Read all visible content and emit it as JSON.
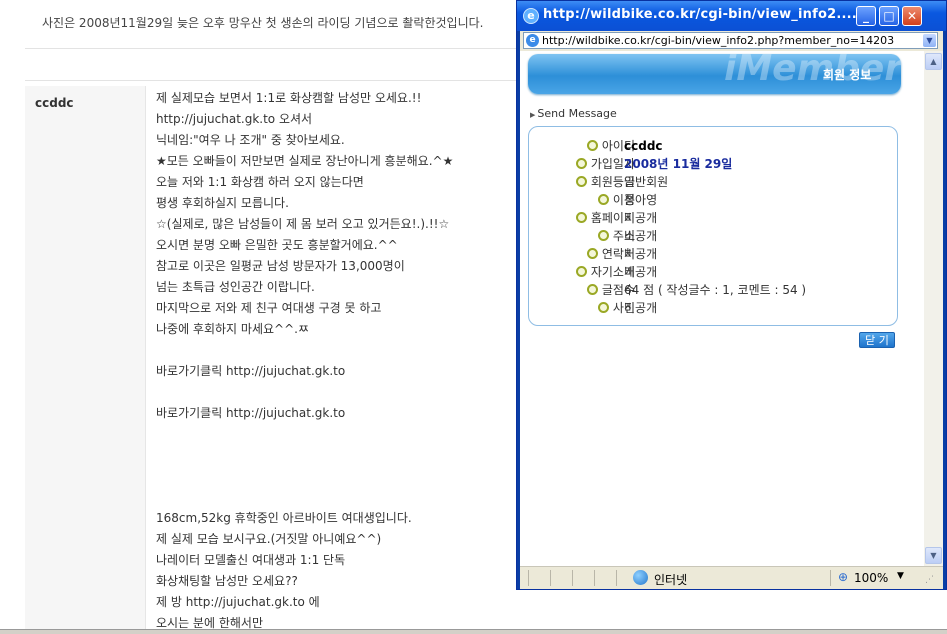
{
  "background_page": {
    "caption": "사진은 2008년11월29일 늦은 오후 망우산 첫 생손의 라이딩 기념으로 촬락한것입니다.",
    "author": "ccddc",
    "post_lines": [
      "제 실제모습 보면서 1:1로 화상캠할 남성만 오세요.!!",
      "http://jujuchat.gk.to 오셔서",
      "닉네임:\"여우 나 조개\" 중 찾아보세요.",
      "★모든 오빠들이 저만보면 실제로 장난아니게 흥분해요.^★",
      "오늘 저와 1:1 화상캠 하러 오지 않는다면",
      "평생 후회하실지 모릅니다.",
      "☆(실제로, 많은 남성들이 제 몸 보러 오고 있거든요!.).!!☆",
      "오시면 분명 오빠 은밀한 곳도 흥분할거에요.^^",
      "참고로 이곳은 일평균 남성 방문자가 13,000명이",
      "넘는 초특급 성인공간 이랍니다.",
      "마지막으로 저와 제 친구 여대생 구경 못 하고",
      "나중에 후회하지 마세요^^.ㅉ",
      "",
      "바로가기클릭 http://jujuchat.gk.to",
      "",
      "바로가기클릭 http://jujuchat.gk.to",
      "",
      "",
      "",
      "",
      "168cm,52kg 휴학중인 아르바이트 여대생입니다.",
      "제 실제 모습 보시구요.(거짓말 아니예요^^)",
      "나레이터 모델출신 여대생과 1:1 단독",
      "화상채팅할 남성만 오세요??",
      "제 방 http://jujuchat.gk.to 에",
      "오시는 분에 한해서만"
    ]
  },
  "popup": {
    "title": "http://wildbike.co.kr/cgi-bin/view_info2....",
    "address": "http://wildbike.co.kr/cgi-bin/view_info2.php?member_no=14203",
    "banner_watermark": "iMember",
    "banner_title": "회원 정보",
    "send_message": "Send Message",
    "fields": [
      {
        "label": "아이디",
        "value": "ccddc",
        "style": "bold"
      },
      {
        "label": "가입일자",
        "value": "2008년 11월 29일",
        "style": "blue"
      },
      {
        "label": "회원등급",
        "value": "일반회원",
        "style": ""
      },
      {
        "label": "이름",
        "value": "정아영",
        "style": ""
      },
      {
        "label": "홈페이지",
        "value": "비공개",
        "style": ""
      },
      {
        "label": "주소",
        "value": "비공개",
        "style": ""
      },
      {
        "label": "연락처",
        "value": "비공개",
        "style": ""
      },
      {
        "label": "자기소개",
        "value": "비공개",
        "style": ""
      },
      {
        "label": "글점수",
        "value": "64 점 ( 작성글수 : 1, 코멘트 : 54 )",
        "style": ""
      },
      {
        "label": "사진",
        "value": "비공개",
        "style": ""
      }
    ],
    "close_label": "닫 기",
    "status_zone": "인터넷",
    "status_zoom": "100%"
  },
  "colors": {
    "titlebar": "#0a58e0",
    "banner": "#2d8fd8",
    "link_blue": "#1a2c9e",
    "bullet": "#9aa825"
  }
}
